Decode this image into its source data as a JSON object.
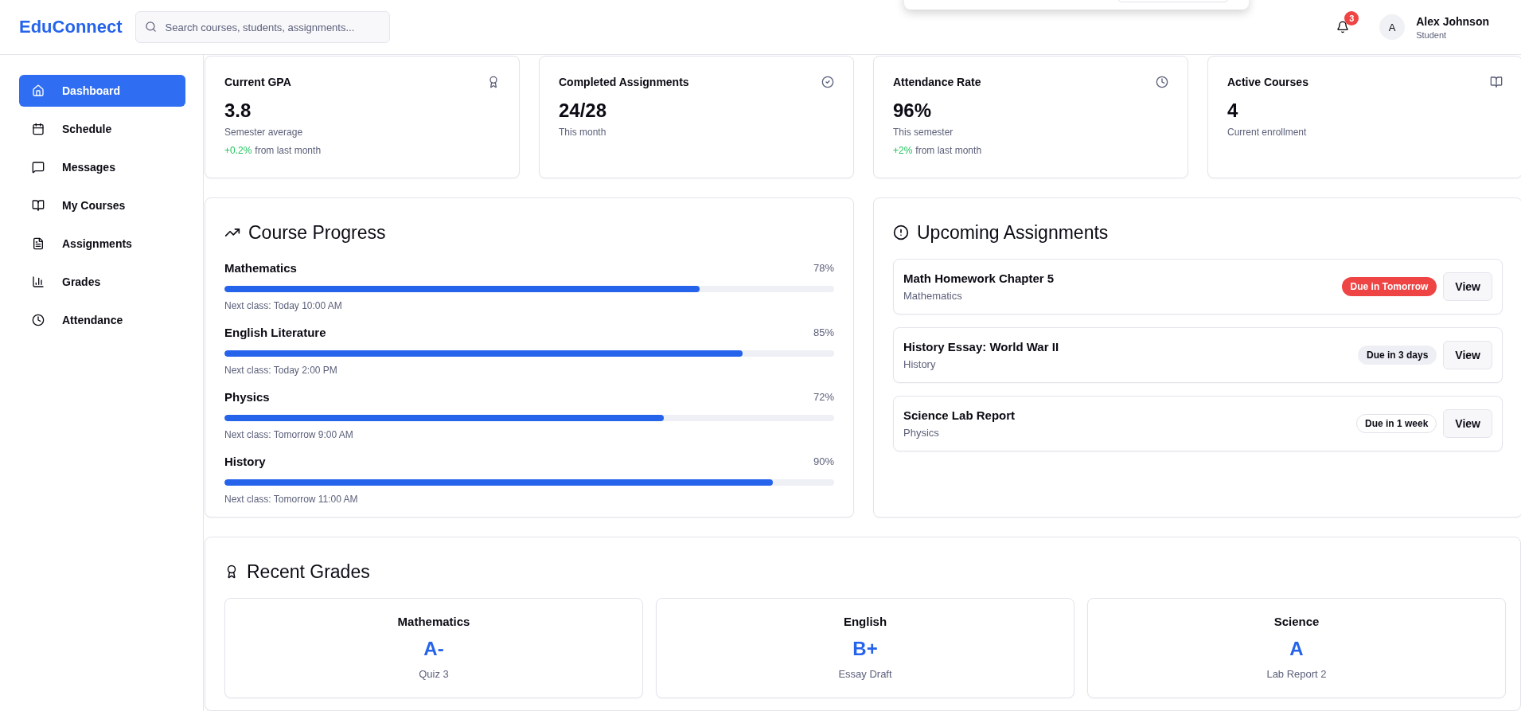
{
  "header": {
    "logo": "EduConnect",
    "search": {
      "placeholder": "Search courses, students, assignments..."
    },
    "notifications": {
      "count": "3"
    },
    "user": {
      "initial": "A",
      "name": "Alex Johnson",
      "role": "Student"
    }
  },
  "sidebar": {
    "items": [
      {
        "label": "Dashboard",
        "selected": true
      },
      {
        "label": "Schedule",
        "selected": false
      },
      {
        "label": "Messages",
        "selected": false
      },
      {
        "label": "My Courses",
        "selected": false
      },
      {
        "label": "Assignments",
        "selected": false
      },
      {
        "label": "Grades",
        "selected": false
      },
      {
        "label": "Attendance",
        "selected": false
      }
    ]
  },
  "stats": [
    {
      "title": "Current GPA",
      "value": "3.8",
      "caption": "Semester average",
      "change": "+0.2%",
      "change_note": "from last month"
    },
    {
      "title": "Completed Assignments",
      "value": "24/28",
      "caption": "This month"
    },
    {
      "title": "Attendance Rate",
      "value": "96%",
      "caption": "This semester",
      "change": "+2%",
      "change_note": "from last month"
    },
    {
      "title": "Active Courses",
      "value": "4",
      "caption": "Current enrollment"
    }
  ],
  "course_progress": {
    "title": "Course Progress",
    "courses": [
      {
        "name": "Mathematics",
        "percent": "78%",
        "level": 0.78,
        "next_class": "Next class: Today 10:00 AM"
      },
      {
        "name": "English Literature",
        "percent": "85%",
        "level": 0.85,
        "next_class": "Next class: Today 2:00 PM"
      },
      {
        "name": "Physics",
        "percent": "72%",
        "level": 0.72,
        "next_class": "Next class: Tomorrow 9:00 AM"
      },
      {
        "name": "History",
        "percent": "90%",
        "level": 0.9,
        "next_class": "Next class: Tomorrow 11:00 AM"
      }
    ]
  },
  "upcoming_assignments": {
    "title": "Upcoming Assignments",
    "items": [
      {
        "title": "Math Homework Chapter 5",
        "subject": "Mathematics",
        "due": "Due in Tomorrow",
        "kind": "urgent",
        "action": "View"
      },
      {
        "title": "History Essay: World War II",
        "subject": "History",
        "due": "Due in 3 days",
        "kind": "soon",
        "action": "View"
      },
      {
        "title": "Science Lab Report",
        "subject": "Physics",
        "due": "Due in 1 week",
        "kind": "later",
        "action": "View"
      }
    ]
  },
  "recent_grades": {
    "title": "Recent Grades",
    "items": [
      {
        "subject": "Mathematics",
        "grade": "A-",
        "assessment": "Quiz 3"
      },
      {
        "subject": "English",
        "grade": "B+",
        "assessment": "Essay Draft"
      },
      {
        "subject": "Science",
        "grade": "A",
        "assessment": "Lab Report 2"
      }
    ]
  }
}
